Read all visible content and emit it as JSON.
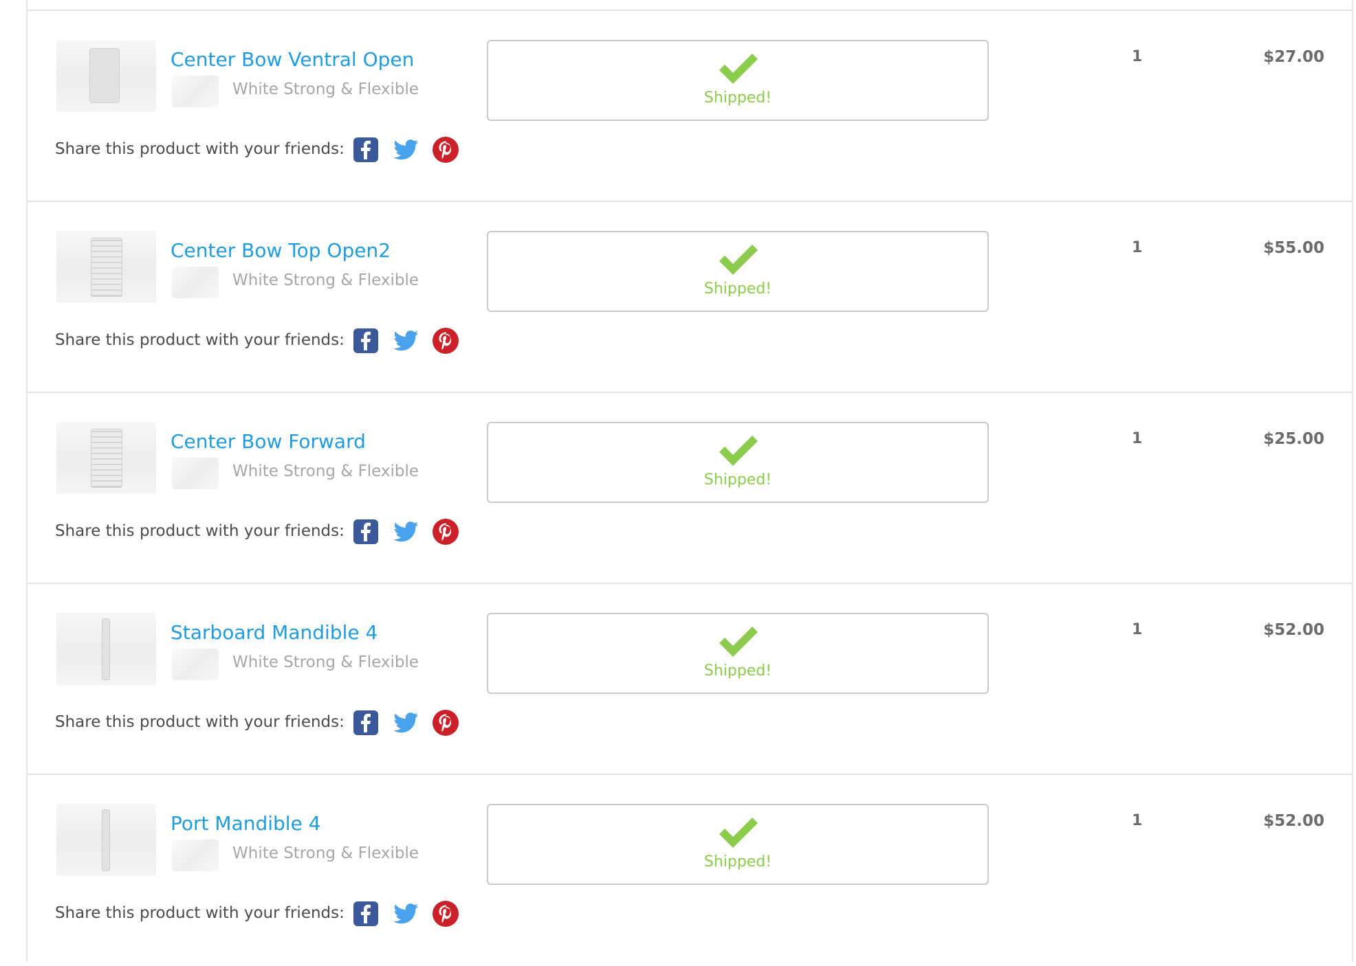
{
  "share_label": "Share this product with your friends:",
  "status_color": "#8ccc4c",
  "link_color": "#1f9be0",
  "icons": {
    "facebook": "facebook-icon",
    "twitter": "twitter-icon",
    "pinterest": "pinterest-icon",
    "status": "checkmark-icon"
  },
  "items": [
    {
      "name": "Center Bow Ventral Open",
      "material": "White Strong & Flexible",
      "status": "Shipped!",
      "quantity": "1",
      "price": "$27.00"
    },
    {
      "name": "Center Bow Top Open2",
      "material": "White Strong & Flexible",
      "status": "Shipped!",
      "quantity": "1",
      "price": "$55.00"
    },
    {
      "name": "Center Bow Forward",
      "material": "White Strong & Flexible",
      "status": "Shipped!",
      "quantity": "1",
      "price": "$25.00"
    },
    {
      "name": "Starboard Mandible 4",
      "material": "White Strong & Flexible",
      "status": "Shipped!",
      "quantity": "1",
      "price": "$52.00"
    },
    {
      "name": "Port Mandible 4",
      "material": "White Strong & Flexible",
      "status": "Shipped!",
      "quantity": "1",
      "price": "$52.00"
    }
  ]
}
